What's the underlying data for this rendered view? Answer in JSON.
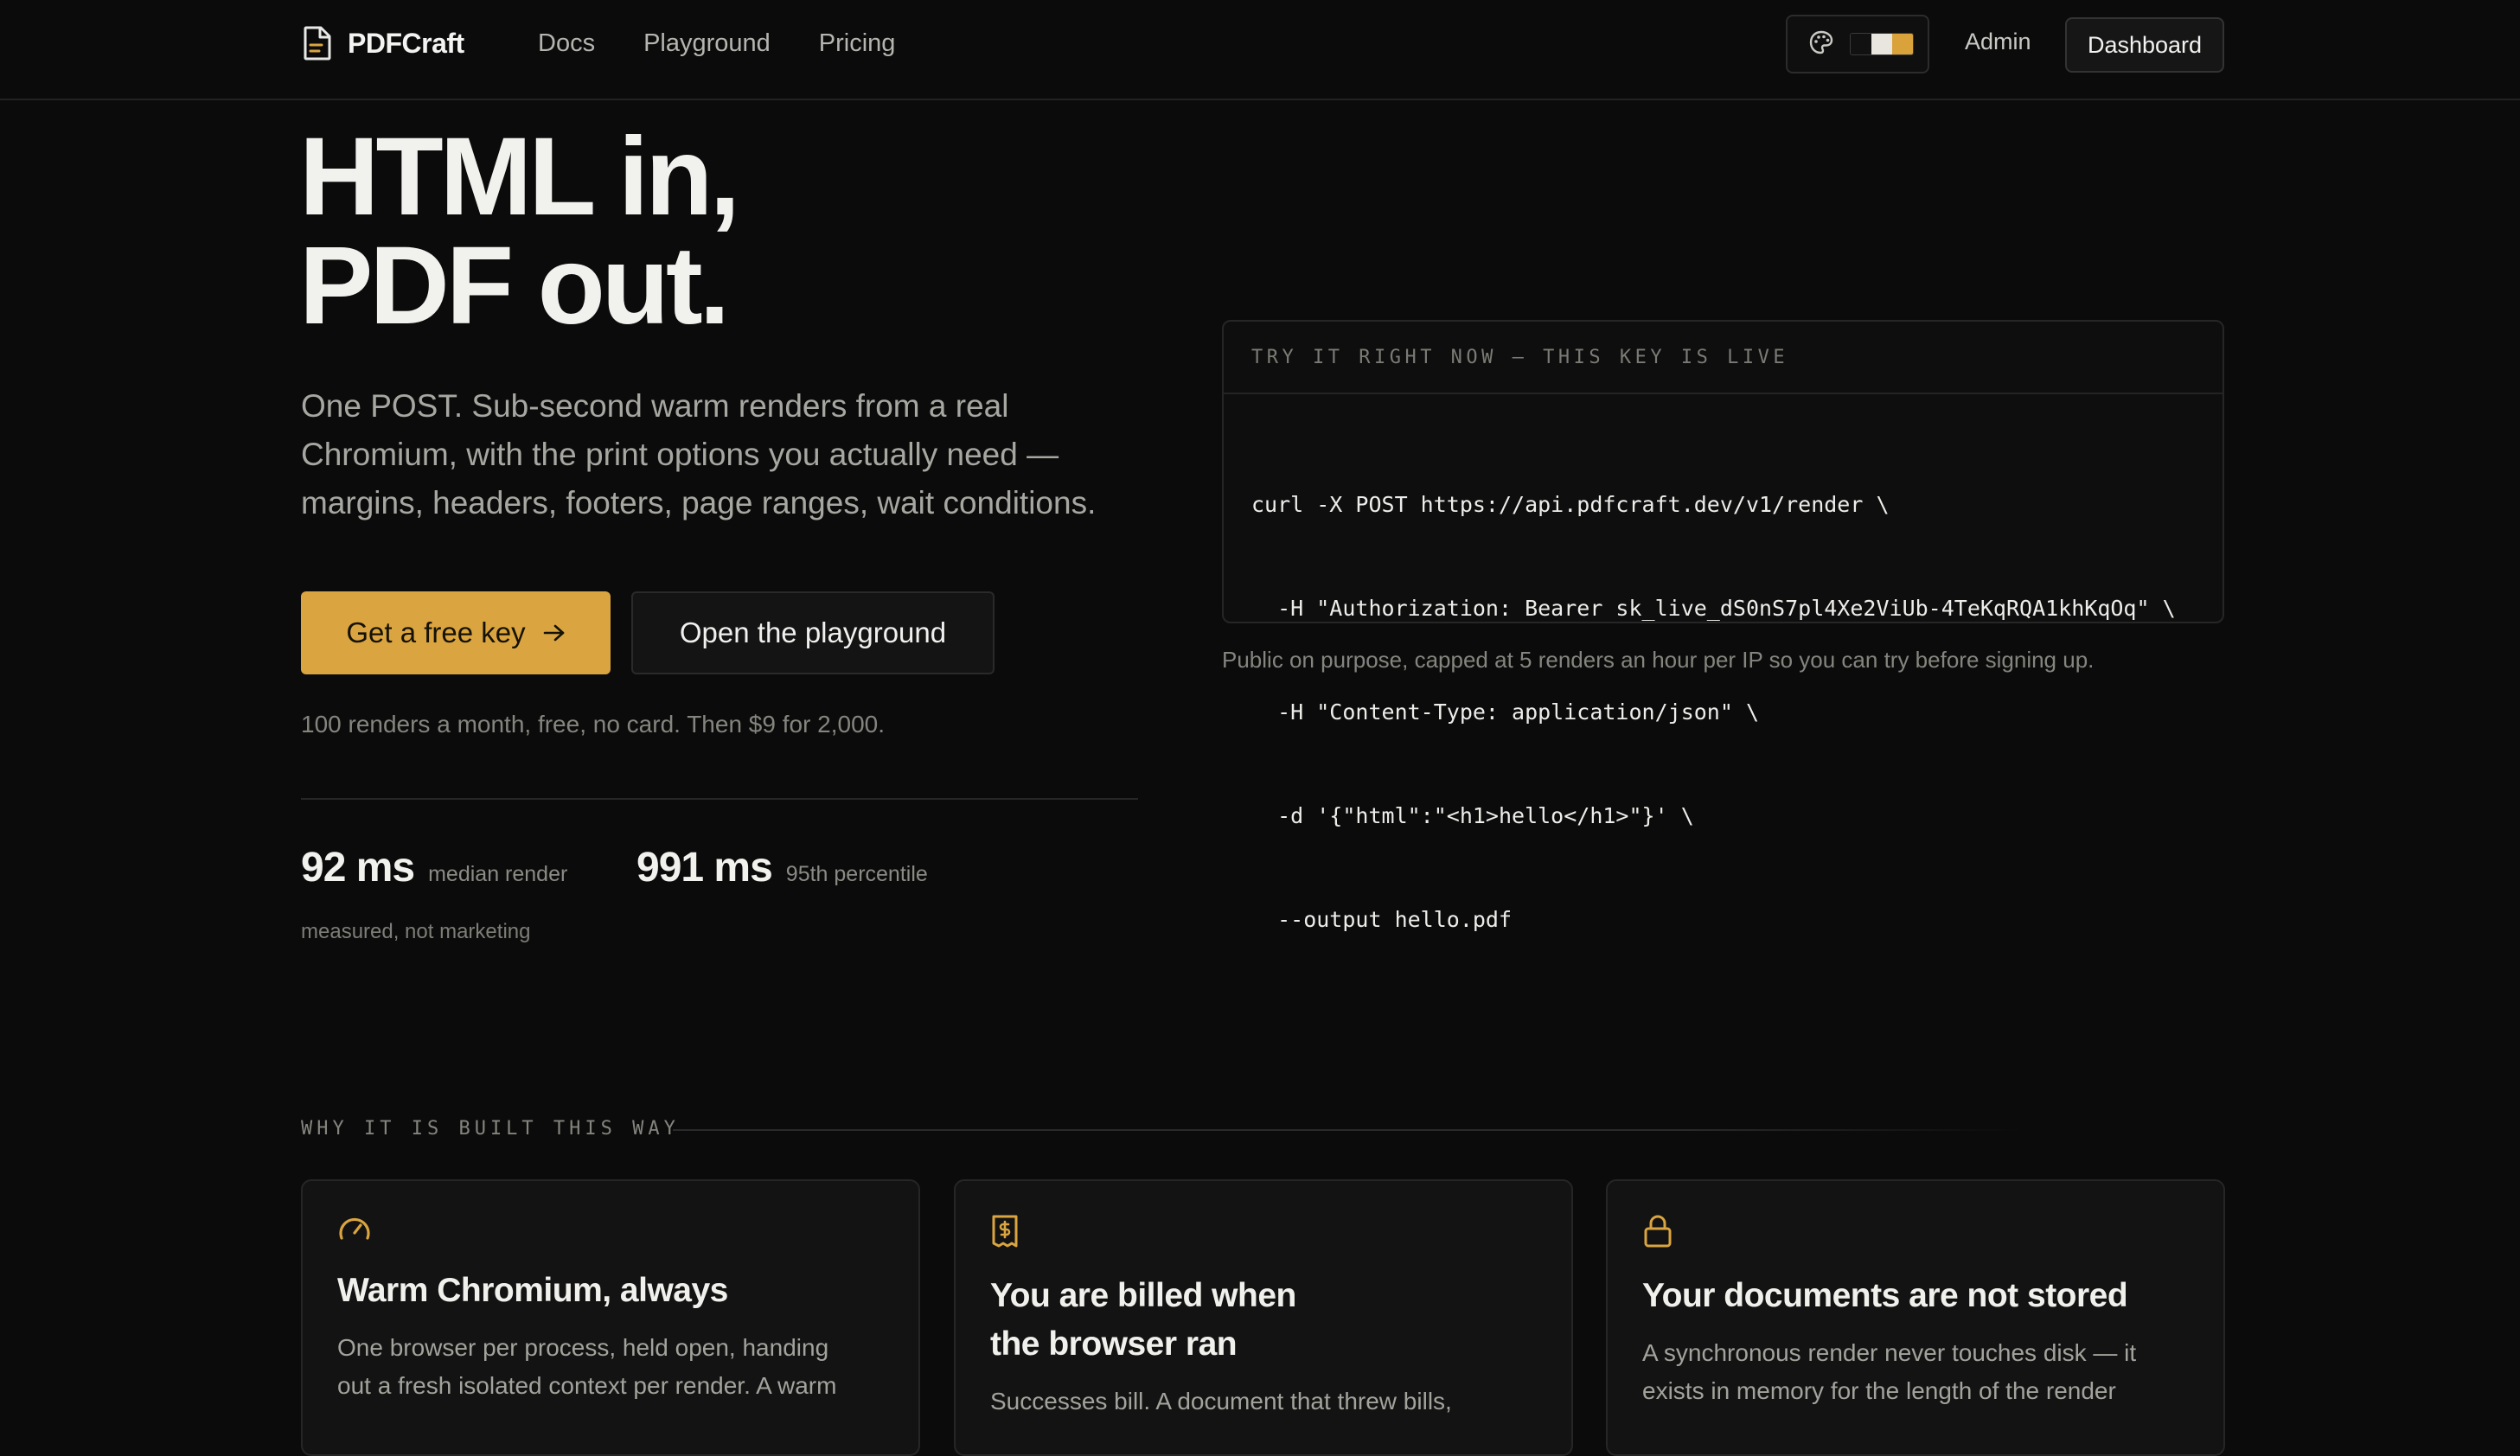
{
  "nav": {
    "brand": "PDFCraft",
    "links": [
      "Docs",
      "Playground",
      "Pricing"
    ],
    "admin": "Admin",
    "dashboard": "Dashboard"
  },
  "hero": {
    "title_lines": [
      "HTML in,",
      "PDF out."
    ],
    "subtitle_lines": [
      "One POST. Sub-second warm renders from a real",
      "Chromium, with the print options you actually need —",
      "margins, headers, footers, page ranges, wait conditions."
    ],
    "primary_cta": "Get a free key",
    "secondary_cta": "Open the playground",
    "fine_print": "100 renders a month, free, no card. Then $9 for 2,000.",
    "stats": [
      {
        "value": "92 ms",
        "label": "median render"
      },
      {
        "value": "991 ms",
        "label": "95th percentile"
      }
    ],
    "stats_note": "measured, not marketing"
  },
  "code_sample": {
    "header": "TRY IT RIGHT NOW — THIS KEY IS LIVE",
    "lines": [
      "curl -X POST https://api.pdfcraft.dev/v1/render \\",
      "  -H \"Authorization: Bearer sk_live_dS0nS7pl4Xe2ViUb-4TeKqRQA1khKqOq\" \\",
      "  -H \"Content-Type: application/json\" \\",
      "  -d '{\"html\":\"<h1>hello</h1>\"}' \\",
      "  --output hello.pdf"
    ],
    "note": "Public on purpose, capped at 5 renders an hour per IP so you can try before signing up."
  },
  "features": {
    "section_label": "WHY IT IS BUILT THIS WAY",
    "cards": [
      {
        "icon": "gauge-icon",
        "title_lines": [
          "Warm Chromium, always"
        ],
        "body_lines": [
          "One browser per process, held open, handing",
          "out a fresh isolated context per render. A warm"
        ]
      },
      {
        "icon": "receipt-icon",
        "title_lines": [
          "You are billed when",
          "the browser ran"
        ],
        "body_lines": [
          "Successes bill. A document that threw bills,"
        ]
      },
      {
        "icon": "lock-icon",
        "title_lines": [
          "Your documents are not stored"
        ],
        "body_lines": [
          "A synchronous render never touches disk — it",
          "exists in memory for the length of the render"
        ]
      }
    ]
  },
  "colors": {
    "background": "#0b0b0b",
    "accent": "#daa540",
    "card": "#131313"
  }
}
